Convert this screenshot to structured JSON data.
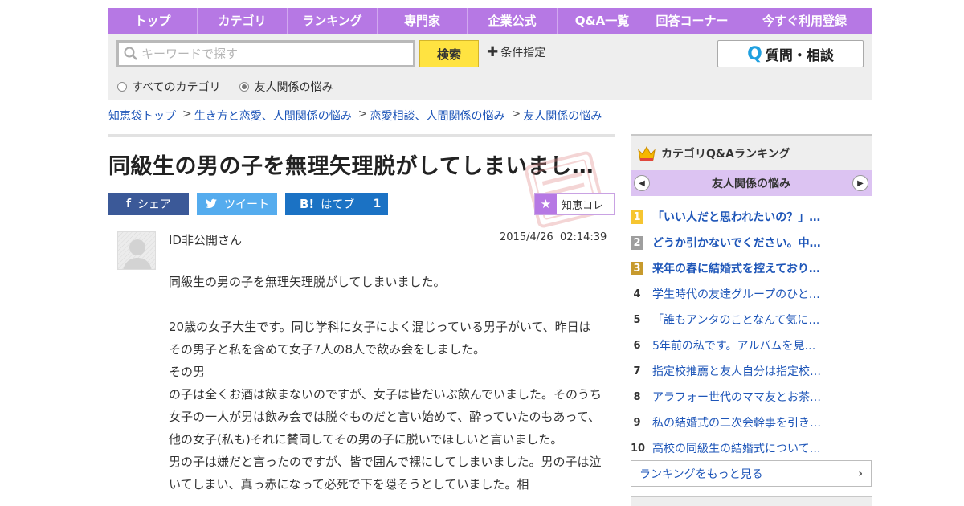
{
  "nav": {
    "items": [
      "トップ",
      "カテゴリ",
      "ランキング",
      "専門家",
      "企業公式",
      "Q&A一覧",
      "回答コーナー",
      "今すぐ利用登録"
    ]
  },
  "search": {
    "placeholder": "キーワードで探す",
    "button_label": "検索",
    "condition_label": "条件指定",
    "ask_label": "質問・相談",
    "radio_all": "すべてのカテゴリ",
    "radio_current": "友人関係の悩み"
  },
  "breadcrumb": {
    "top": "知恵袋トップ",
    "level1": "生き方と恋愛、人間関係の悩み",
    "level2": "恋愛相談、人間関係の悩み",
    "level3": "友人関係の悩み",
    "separator": ">"
  },
  "question": {
    "title": "同級生の男の子を無理矢理脱がしてしまいまし…",
    "share_facebook": "シェア",
    "share_twitter": "ツイート",
    "share_hatena": "はてブ",
    "hatena_count": "1",
    "chiecole_label": "知恵コレ",
    "user": "ID非公開さん",
    "date": "2015/4/26",
    "time": "02:14:39",
    "paragraphs": [
      "同級生の男の子を無理矢理脱がしてしまいました。",
      "20歳の女子大生です。同じ学科に女子によく混じっている男子がいて、昨日はその男子と私を含めて女子7人の8人で飲み会をしました。",
      "その男",
      "の子は全くお酒は飲まないのですが、女子は皆だいぶ飲んでいました。そのうち女子の一人が男は飲み会では脱ぐものだと言い始めて、酔っていたのもあって、他の女子(私も)それに賛同してその男の子に脱いでほしいと言いました。",
      "男の子は嫌だと言ったのですが、皆で囲んで裸にしてしまいました。男の子は泣いてしまい、真っ赤になって必死で下を隠そうとしていました。相"
    ]
  },
  "sidebar": {
    "heading": "カテゴリQ&Aランキング",
    "category": "友人関係の悩み",
    "ranking": [
      {
        "rank": "1",
        "text": "「いい人だと思われたいの？」…"
      },
      {
        "rank": "2",
        "text": "どうか引かないでください。中…"
      },
      {
        "rank": "3",
        "text": "来年の春に結婚式を控えており…"
      },
      {
        "rank": "4",
        "text": "学生時代の友達グループのひと…"
      },
      {
        "rank": "5",
        "text": "「誰もアンタのことなんて気に…"
      },
      {
        "rank": "6",
        "text": "5年前の私です。アルバムを見…"
      },
      {
        "rank": "7",
        "text": "指定校推薦と友人自分は指定校…"
      },
      {
        "rank": "8",
        "text": "アラフォー世代のママ友とお茶…"
      },
      {
        "rank": "9",
        "text": "私の結婚式の二次会幹事を引き…"
      },
      {
        "rank": "10",
        "text": "高校の同級生の結婚式について…"
      }
    ],
    "more_label": "ランキングをもっと見る"
  },
  "colors": {
    "nav_bg": "#b678e4",
    "search_button": "#ffe341",
    "link": "#1d55b8",
    "facebook": "#3b5998",
    "twitter": "#55acee",
    "hatena": "#1b72c4",
    "rank1": "#f6c531",
    "rank2": "#9e9e9e",
    "rank3": "#c79a2d"
  },
  "icons": {
    "search": "search-icon",
    "plus": "plus-icon",
    "question": "q-icon",
    "crown": "crown-icon",
    "facebook": "facebook-icon",
    "twitter": "twitter-icon",
    "hatena": "hatena-icon",
    "star": "star-icon",
    "stamp": "stamp-icon"
  }
}
